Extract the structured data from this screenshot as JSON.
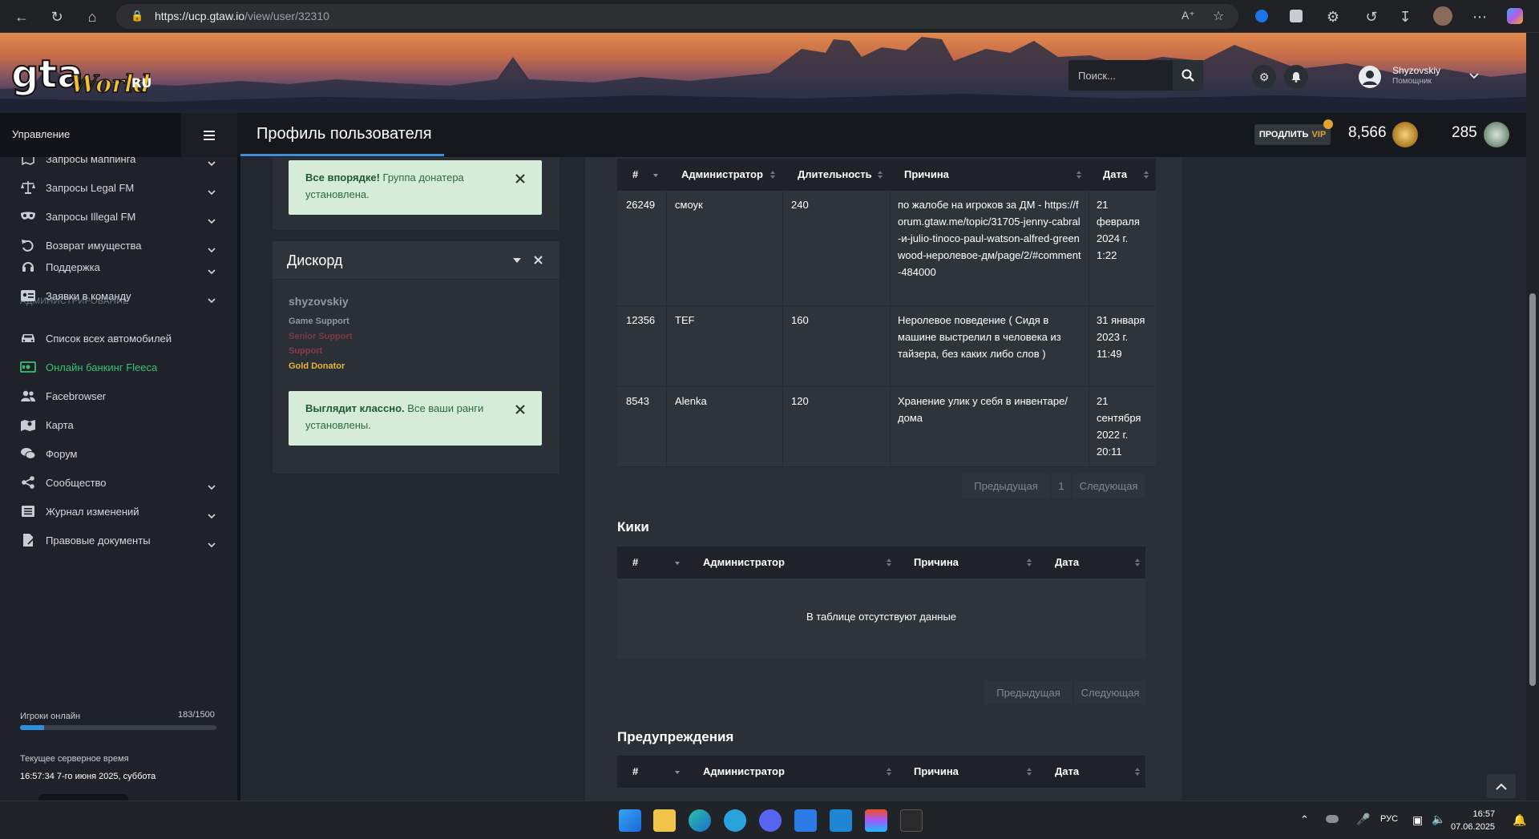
{
  "browser": {
    "url_domain": "https://ucp.gtaw.io",
    "url_path": "/view/user/32310"
  },
  "banner": {
    "search_placeholder": "Поиск...",
    "user_name": "Shyzovskiy",
    "user_role": "Помощник"
  },
  "header": {
    "sidebar_label": "Управление",
    "page_title": "Профиль пользователя",
    "vip_prefix": "продлить",
    "vip_label": "VIP",
    "coins_value": "8,566",
    "points_value": "285"
  },
  "sidebar": {
    "items_top": [
      {
        "label": "Запросы маппинга",
        "icon": "map-icon"
      },
      {
        "label": "Запросы Legal FM",
        "icon": "scales-icon"
      },
      {
        "label": "Запросы Illegal FM",
        "icon": "mask-icon"
      },
      {
        "label": "Возврат имущества",
        "icon": "undo-icon"
      }
    ],
    "admin_heading": "АДМИНИСТРИРОВАНИЕ",
    "items_admin": [
      {
        "label": "Поддержка",
        "icon": "headset-icon"
      },
      {
        "label": "Заявки в команду",
        "icon": "id-card-icon"
      }
    ],
    "items_bottom": [
      {
        "label": "Список всех автомобилей",
        "icon": "car-icon"
      },
      {
        "label": "Онлайн банкинг Fleeca",
        "icon": "money-icon"
      },
      {
        "label": "Facebrowser",
        "icon": "users-icon"
      },
      {
        "label": "Карта",
        "icon": "map-marker-icon"
      },
      {
        "label": "Форум",
        "icon": "comments-icon"
      },
      {
        "label": "Сообщество",
        "icon": "share-icon"
      },
      {
        "label": "Журнал изменений",
        "icon": "list-icon"
      },
      {
        "label": "Правовые документы",
        "icon": "document-icon"
      }
    ],
    "online_label": "Игроки онлайн",
    "online_count": "183/1500",
    "online_fraction": 0.122,
    "time_label": "Текущее серверное время",
    "time_value": "16:57:34 7-го июня 2025, суббота"
  },
  "left_card": {
    "alert1_strong": "Все впорядке!",
    "alert1_text": " Группа донатера установлена.",
    "discord_title": "Дискорд",
    "discord_user": "shyzovskiy",
    "roles": [
      {
        "name": "Game Support",
        "color": "#8f979f"
      },
      {
        "name": "Senior Support",
        "color": "#7a3a45"
      },
      {
        "name": "Support",
        "color": "#8a3a4a"
      },
      {
        "name": "Gold Donator",
        "color": "#e7b43b"
      }
    ],
    "alert2_strong": "Выглядит классно.",
    "alert2_text": " Все ваши ранги установлены."
  },
  "bans_table": {
    "headers": [
      "#",
      "Администратор",
      "Длительность",
      "Причина",
      "Дата"
    ],
    "rows": [
      {
        "id": "26249",
        "admin": "смоук",
        "duration": "240",
        "reason": "по жалобе на игроков за ДМ - https://forum.gtaw.me/topic/31705-jenny-cabral-и-julio-tinoco-paul-watson-alfred-greenwood-неролевое-дм/page/2/#comment-484000",
        "date": "21 февраля 2024 г. 1:22"
      },
      {
        "id": "12356",
        "admin": "TEF",
        "duration": "160",
        "reason": "Неролевое поведение ( Сидя в машине выстрелил в человека из тайзера, без каких либо слов )",
        "date": "31 января 2023 г. 11:49"
      },
      {
        "id": "8543",
        "admin": "Alenka",
        "duration": "120",
        "reason": "Хранение улик у себя в инвентаре/дома",
        "date": "21 сентября 2022 г. 20:11"
      }
    ],
    "prev": "Предыдущая",
    "page": "1",
    "next": "Следующая"
  },
  "kicks": {
    "title": "Кики",
    "headers": [
      "#",
      "Администратор",
      "Причина",
      "Дата"
    ],
    "empty": "В таблице отсутствуют данные",
    "prev": "Предыдущая",
    "next": "Следующая"
  },
  "warnings": {
    "title": "Предупреждения",
    "headers": [
      "#",
      "Администратор",
      "Причина",
      "Дата"
    ]
  },
  "taskbar": {
    "lang": "РУС",
    "time": "16:57",
    "date": "07.06.2025"
  }
}
